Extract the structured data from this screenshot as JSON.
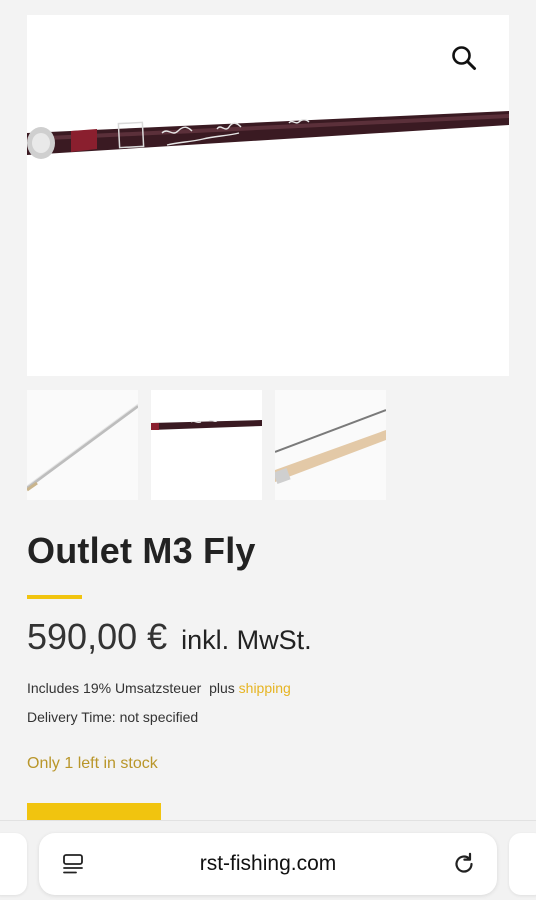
{
  "product": {
    "title": "Outlet M3 Fly",
    "price_amount": "590,00 €",
    "price_tax_label": "inkl. MwSt.",
    "tax_info_text": "Includes 19% Umsatzsteuer  plus ",
    "shipping_link": "shipping",
    "delivery_time": "Delivery Time: not specified",
    "stock_status": "Only 1 left in stock"
  },
  "gallery": {
    "thumbnails": [
      {
        "label": "rod-blank-thumbnail"
      },
      {
        "label": "rod-logo-thumbnail"
      },
      {
        "label": "rod-handle-thumbnail"
      }
    ]
  },
  "browser": {
    "url": "rst-fishing.com"
  },
  "colors": {
    "accent": "#f1c40f",
    "stock": "#b9962a",
    "link": "#e6b422",
    "rod": "#3a1a22"
  },
  "icons": {
    "zoom": "search-icon",
    "reader": "reader-mode-icon",
    "reload": "reload-icon"
  }
}
